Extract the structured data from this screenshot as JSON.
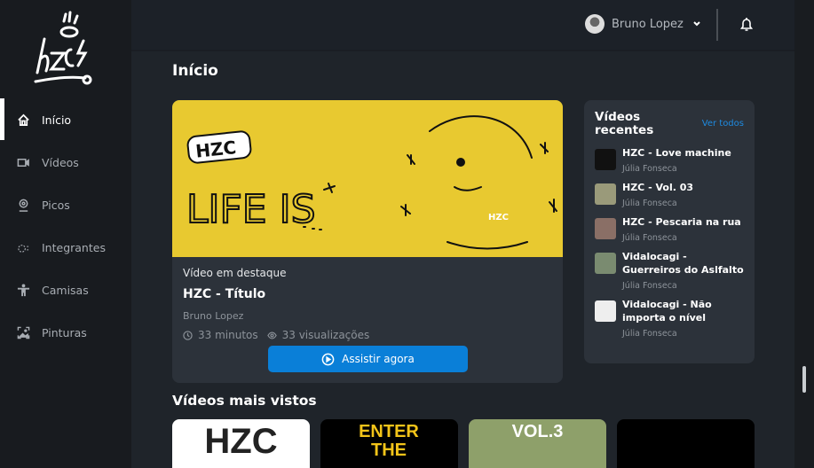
{
  "sidebar": {
    "items": [
      {
        "label": "Início",
        "icon": "home-icon",
        "active": true
      },
      {
        "label": "Vídeos",
        "icon": "video-icon"
      },
      {
        "label": "Picos",
        "icon": "location-icon"
      },
      {
        "label": "Integrantes",
        "icon": "users-icon"
      },
      {
        "label": "Camisas",
        "icon": "person-icon"
      },
      {
        "label": "Pinturas",
        "icon": "image-icon"
      }
    ]
  },
  "header": {
    "user_name": "Bruno Lopez"
  },
  "page_title": "Início",
  "featured": {
    "eyebrow": "Vídeo em destaque",
    "title": "HZC - Título",
    "author": "Bruno Lopez",
    "duration": "33 minutos",
    "views": "33 visualizações",
    "cta": "Assistir agora",
    "image_text": "LIFE IS"
  },
  "recent": {
    "title": "Vídeos recentes",
    "see_all": "Ver todos",
    "items": [
      {
        "title": "HZC - Love machine",
        "author": "Júlia Fonseca",
        "color": "#111111"
      },
      {
        "title": "HZC - Vol. 03",
        "author": "Júlia Fonseca",
        "color": "#9a9a7a"
      },
      {
        "title": "HZC - Pescaria na rua",
        "author": "Júlia Fonseca",
        "color": "#8a6f66"
      },
      {
        "title": "Vidalocagi - Guerreiros do Aslfalto",
        "author": "Júlia Fonseca",
        "color": "#7a8b70"
      },
      {
        "title": "Vidalocagi - Não importa o nível",
        "author": "Júlia Fonseca",
        "color": "#eeeeee"
      }
    ]
  },
  "most_viewed": {
    "title": "Vídeos mais vistos",
    "items": [
      {
        "label": "HZC",
        "color": "#ffffff"
      },
      {
        "label": "ENTER THE",
        "color": "#000000"
      },
      {
        "label": "VOL.3",
        "color": "#8ea06a"
      },
      {
        "label": "",
        "color": "#000000"
      }
    ]
  }
}
